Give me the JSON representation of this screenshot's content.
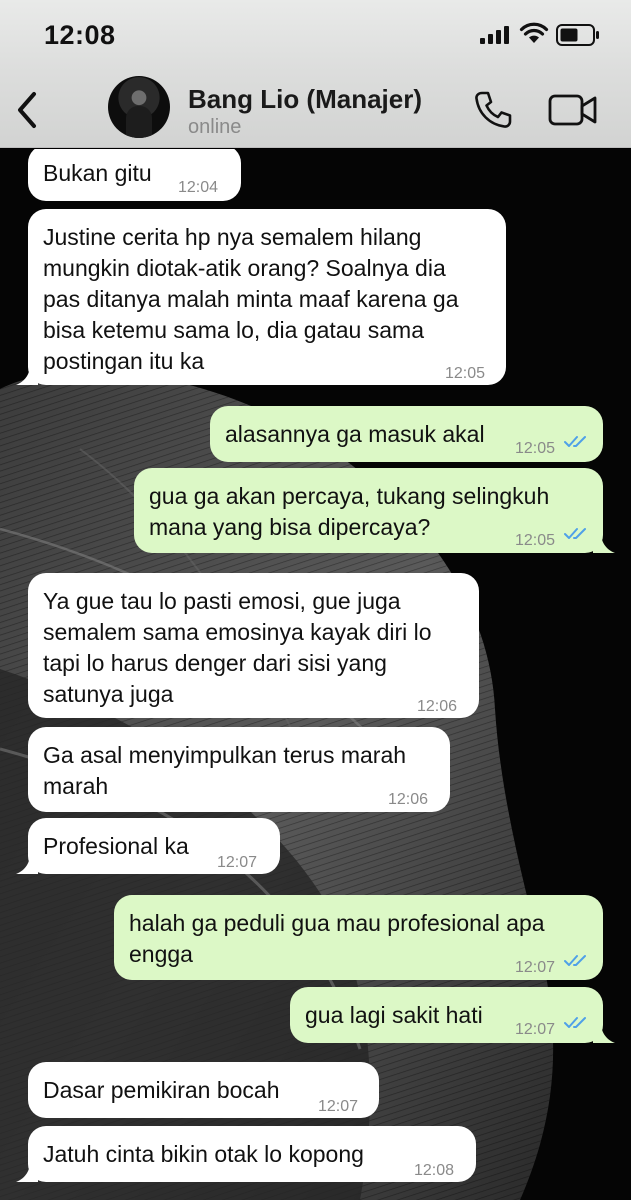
{
  "status": {
    "time": "12:08"
  },
  "header": {
    "contact_name": "Bang Lio (Manajer)",
    "presence": "online",
    "icons": [
      "back-chevron-icon",
      "phone-icon",
      "video-camera-icon"
    ]
  },
  "colors": {
    "incoming": "#ffffff",
    "outgoing": "#dcf8c6",
    "tick": "#4fa0e8"
  },
  "messages": [
    {
      "dir": "in",
      "text": "Bukan gitu",
      "time": "12:04"
    },
    {
      "dir": "in",
      "text": "Justine cerita hp nya semalem hilang\nmungkin diotak-atik orang? Soalnya dia\npas ditanya malah minta maaf karena ga\nbisa ketemu sama lo, dia gatau sama\npostingan itu ka",
      "time": "12:05"
    },
    {
      "dir": "out",
      "text": "alasannya ga masuk akal",
      "time": "12:05",
      "read": true
    },
    {
      "dir": "out",
      "text": "gua ga akan percaya, tukang selingkuh\nmana yang bisa dipercaya?",
      "time": "12:05",
      "read": true
    },
    {
      "dir": "in",
      "text": "Ya gue tau lo pasti emosi, gue juga\nsemalem sama emosinya kayak diri lo\ntapi lo harus denger dari sisi yang\nsatunya juga",
      "time": "12:06"
    },
    {
      "dir": "in",
      "text": "Ga asal menyimpulkan terus marah\nmarah",
      "time": "12:06"
    },
    {
      "dir": "in",
      "text": "Profesional ka",
      "time": "12:07"
    },
    {
      "dir": "out",
      "text": "halah ga peduli gua mau profesional apa\nengga",
      "time": "12:07",
      "read": true
    },
    {
      "dir": "out",
      "text": "gua lagi sakit hati",
      "time": "12:07",
      "read": true
    },
    {
      "dir": "in",
      "text": "Dasar pemikiran bocah",
      "time": "12:07"
    },
    {
      "dir": "in",
      "text": "Jatuh cinta bikin otak lo kopong",
      "time": "12:08"
    }
  ]
}
